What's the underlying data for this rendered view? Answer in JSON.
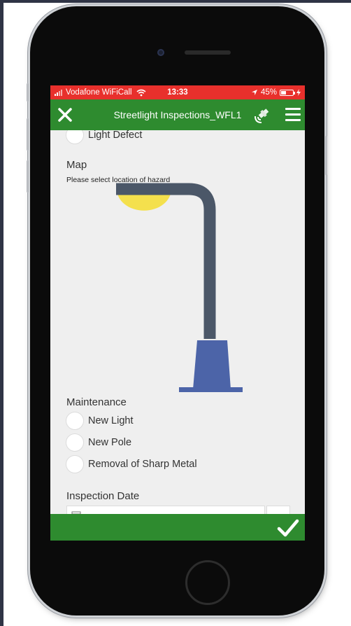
{
  "status_bar": {
    "carrier": "Vodafone WiFiCall",
    "time": "13:33",
    "battery": "45%",
    "battery_level": 0.45
  },
  "header": {
    "title": "Streetlight Inspections_WFL1"
  },
  "form": {
    "previous_option": "Light Defect",
    "map_label": "Map",
    "map_hint": "Please select location of hazard",
    "maintenance_label": "Maintenance",
    "maintenance_options": [
      "New Light",
      "New Pole",
      "Removal of Sharp Metal"
    ],
    "inspection_date_label": "Inspection Date"
  },
  "colors": {
    "status_bar": "#e8302c",
    "header": "#2e8b2f",
    "background": "#efefef",
    "lamp_light": "#f4e04d",
    "pole": "#4b5768",
    "base": "#4c64a8"
  },
  "icons": {
    "close": "close-icon",
    "gps": "satellite-gps-icon",
    "menu": "hamburger-menu-icon",
    "submit": "checkmark-icon",
    "calendar": "calendar-icon"
  }
}
